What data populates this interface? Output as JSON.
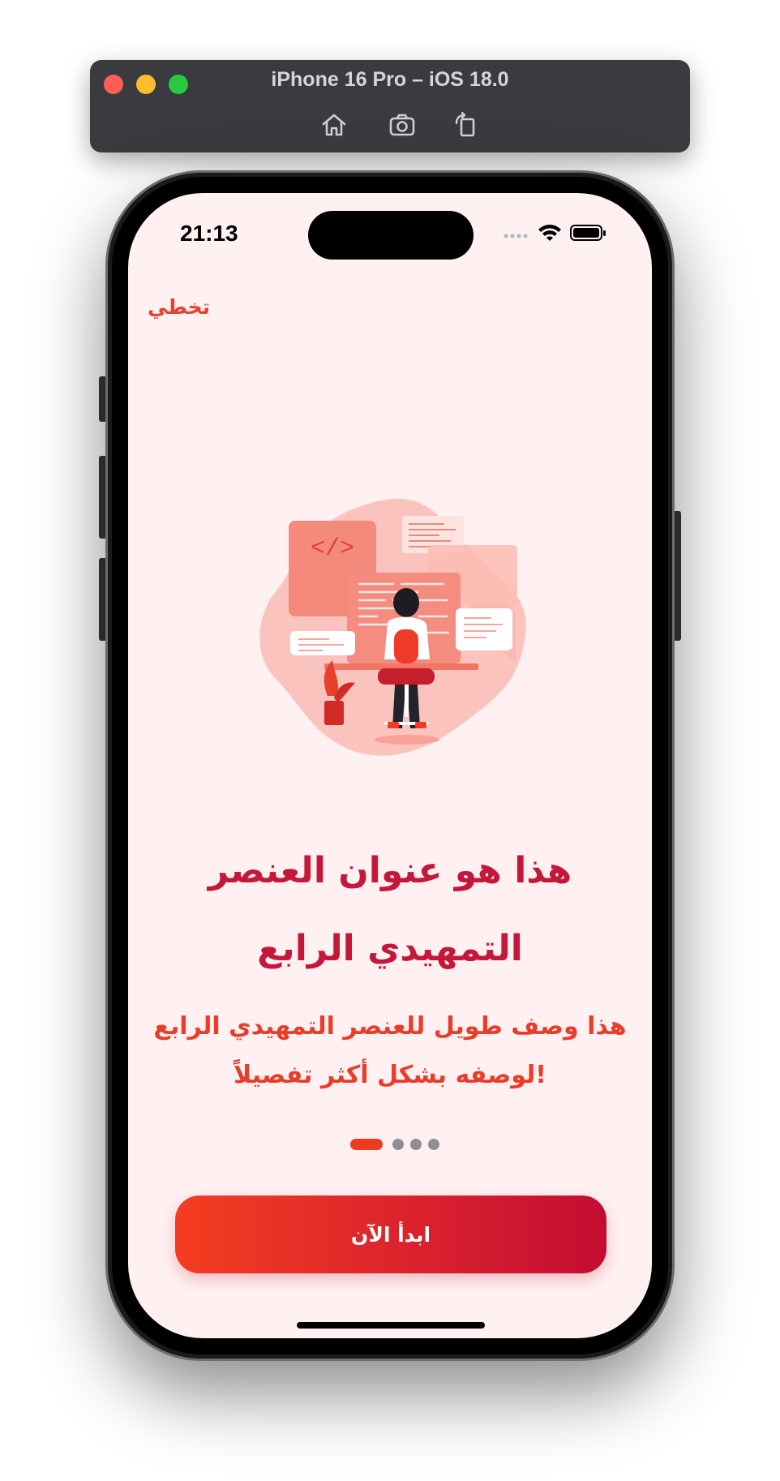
{
  "simulator": {
    "title": "iPhone 16 Pro – iOS 18.0",
    "buttons": [
      "home-icon",
      "screenshot-icon",
      "rotate-icon"
    ]
  },
  "status_bar": {
    "time": "21:13",
    "icons": [
      "signal-icon",
      "wifi-icon",
      "battery-icon"
    ]
  },
  "onboarding": {
    "skip_label": "تخطي",
    "title": "هذا هو عنوان العنصر التمهيدي الرابع",
    "description": "هذا وصف طويل للعنصر التمهيدي الرابع لوصفه بشكل أكثر تفصيلاً!",
    "page_indicator": {
      "pages": 4,
      "current": 1
    },
    "cta_label": "ابدأ الآن",
    "illustration_icon": "developer-illustration",
    "code_symbol": "</>"
  },
  "colors": {
    "background": "#fff1f1",
    "accent": "#ef3a22",
    "title": "#c4183a",
    "gradient_start": "#f43d20",
    "gradient_end": "#c40c32"
  }
}
